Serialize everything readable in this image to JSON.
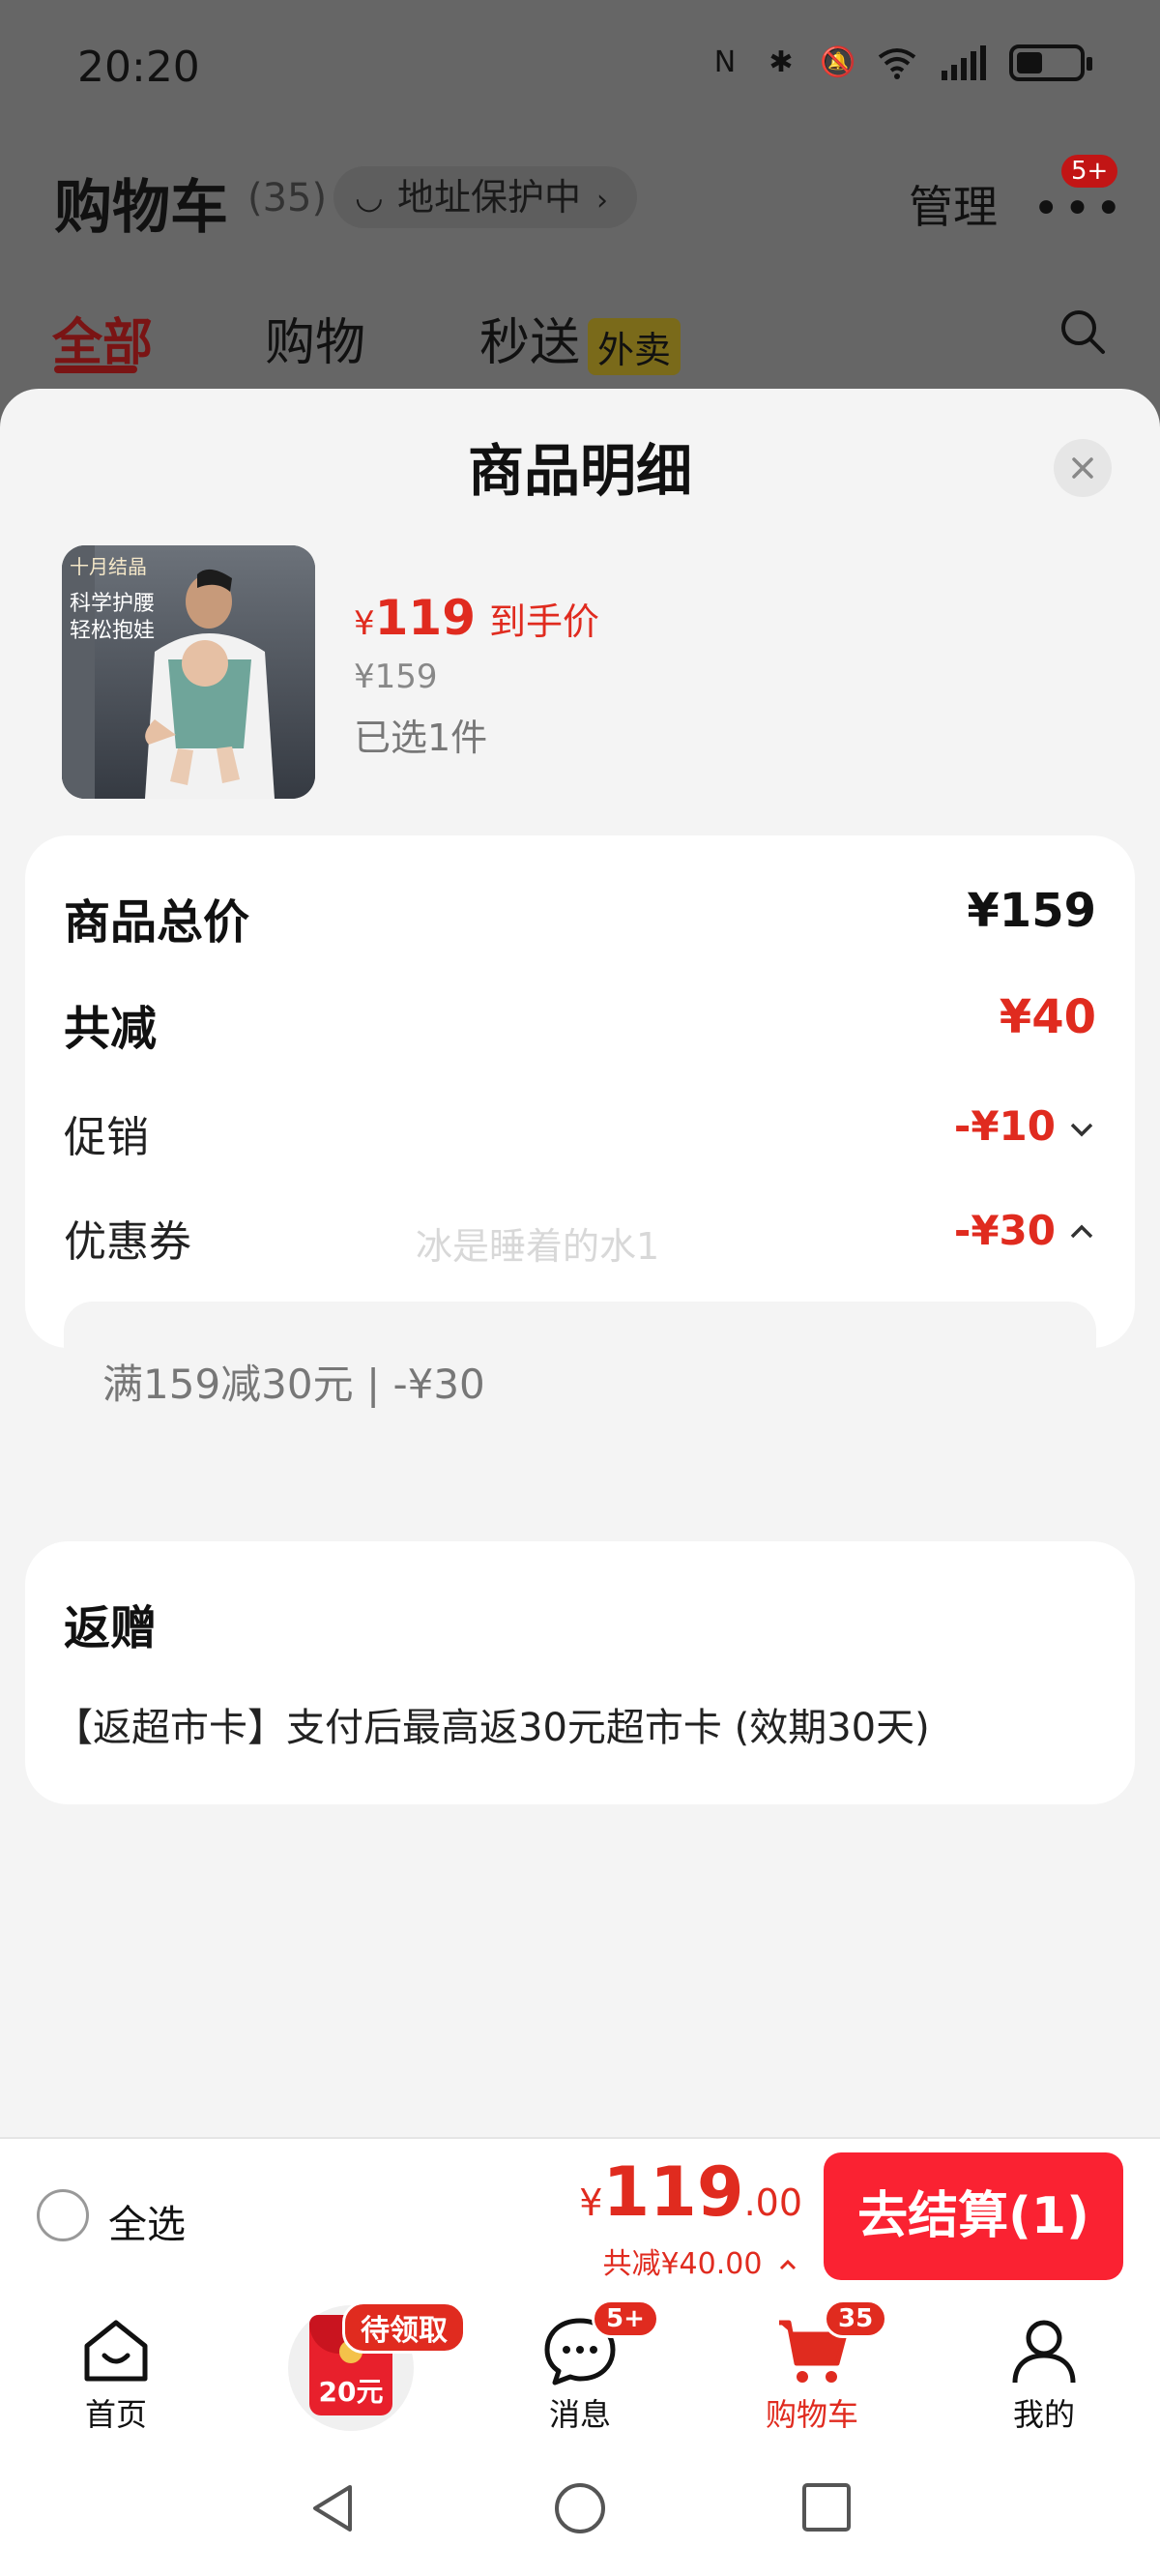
{
  "status_bar": {
    "time": "20:20"
  },
  "cart_header": {
    "title": "购物车",
    "count": "(35)",
    "address_protect": "地址保护中",
    "manage": "管理",
    "more_badge": "5+"
  },
  "tabs": [
    {
      "label": "全部",
      "active": true
    },
    {
      "label": "购物",
      "active": false
    },
    {
      "label": "秒送",
      "active": false,
      "tag": "外卖"
    }
  ],
  "sheet": {
    "title": "商品明细",
    "product": {
      "image_text_1": "十月结晶",
      "image_text_2": "科学护腰",
      "image_text_3": "轻松抱娃",
      "price_symbol": "¥",
      "price": "119",
      "price_tag": "到手价",
      "original_price": "¥159",
      "selected": "已选1件"
    },
    "breakdown": {
      "total_label": "商品总价",
      "total_value": "¥159",
      "reduced_label": "共减",
      "reduced_value": "¥40",
      "promo_label": "促销",
      "promo_value": "-¥10",
      "coupon_label": "优惠券",
      "coupon_value": "-¥30",
      "coupon_detail": "满159减30元 | -¥30"
    },
    "watermark": "冰是睡着的水1",
    "gift": {
      "title": "返赠",
      "text": "【返超市卡】支付后最高返30元超市卡 (效期30天)"
    }
  },
  "checkout": {
    "select_all": "全选",
    "price_symbol": "¥",
    "price_int": "119",
    "price_dec": ".00",
    "discount": "共减¥40.00",
    "button": "去结算(1)"
  },
  "tabbar": {
    "home": "首页",
    "redpack_badge": "待领取",
    "redpack_amount": "20元",
    "messages": "消息",
    "messages_badge": "5+",
    "cart": "购物车",
    "cart_badge": "35",
    "me": "我的"
  },
  "colors": {
    "accent_red": "#e02b1f",
    "checkout_button": "#fa2232",
    "sheet_bg": "#f4f4f4",
    "overlay": "#666666"
  }
}
